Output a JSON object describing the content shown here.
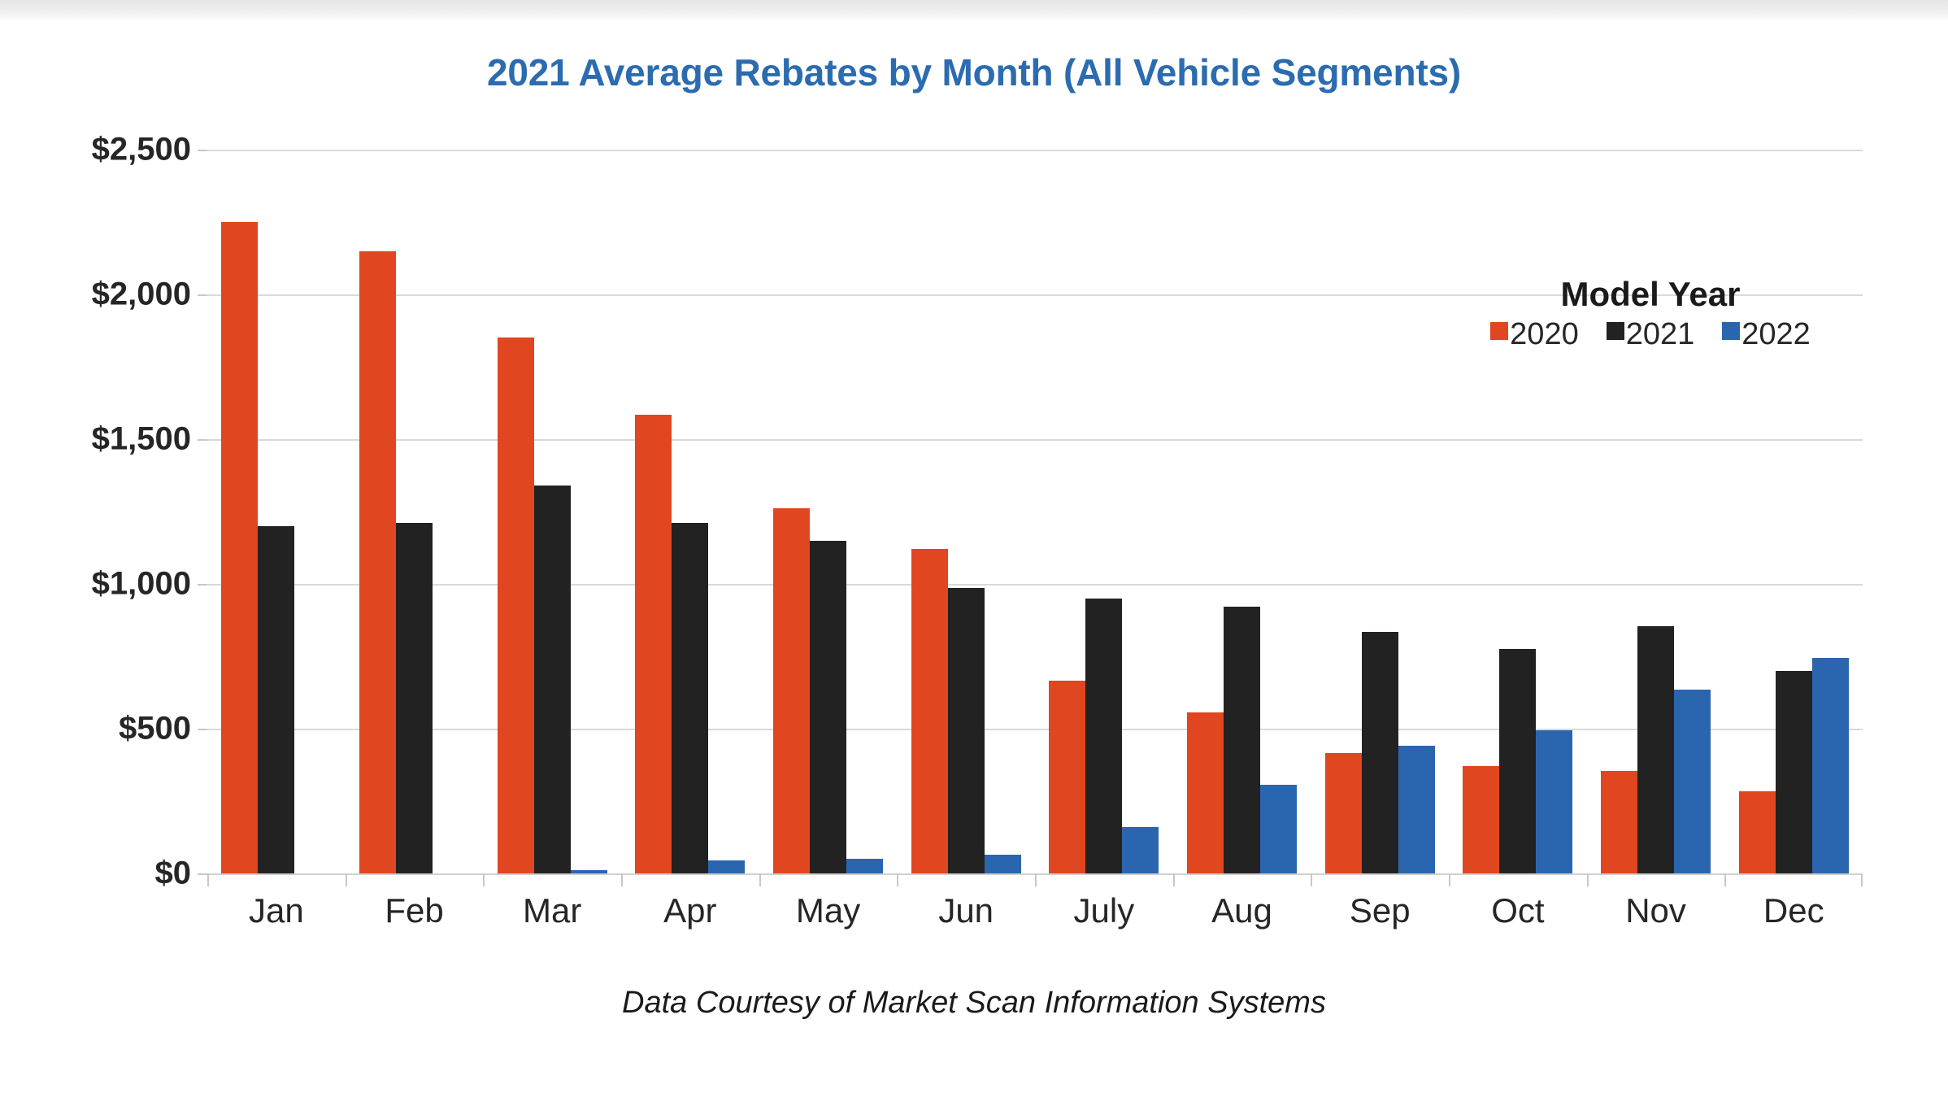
{
  "chart_data": {
    "type": "bar",
    "title": "2021 Average Rebates by Month (All Vehicle Segments)",
    "subtitle": "",
    "xlabel": "",
    "ylabel": "",
    "categories": [
      "Jan",
      "Feb",
      "Mar",
      "Apr",
      "May",
      "Jun",
      "July",
      "Aug",
      "Sep",
      "Oct",
      "Nov",
      "Dec"
    ],
    "series": [
      {
        "name": "2020",
        "color": "#e0461f",
        "values": [
          2250,
          2150,
          1850,
          1585,
          1260,
          1120,
          665,
          555,
          415,
          370,
          355,
          285
        ]
      },
      {
        "name": "2021",
        "color": "#222222",
        "values": [
          1200,
          1210,
          1340,
          1210,
          1150,
          985,
          950,
          920,
          835,
          775,
          855,
          700
        ]
      },
      {
        "name": "2022",
        "color": "#2a66b0",
        "values": [
          0,
          0,
          10,
          45,
          50,
          65,
          160,
          305,
          440,
          495,
          635,
          745
        ]
      }
    ],
    "legend_title": "Model Year",
    "legend_position": "inside-top-right",
    "ylim": [
      0,
      2500
    ],
    "yticks": [
      0,
      500,
      1000,
      1500,
      2000,
      2500
    ],
    "ytick_labels": [
      "$0",
      "$500",
      "$1,000",
      "$1,500",
      "$2,000",
      "$2,500"
    ],
    "grid": true,
    "footnote": "Data Courtesy of Market Scan Information Systems"
  },
  "colors": {
    "title": "#2b6cb0",
    "series_2020": "#e0461f",
    "series_2021": "#222222",
    "series_2022": "#2a66b0",
    "gridline": "#d9d9d9",
    "text": "#262626"
  }
}
